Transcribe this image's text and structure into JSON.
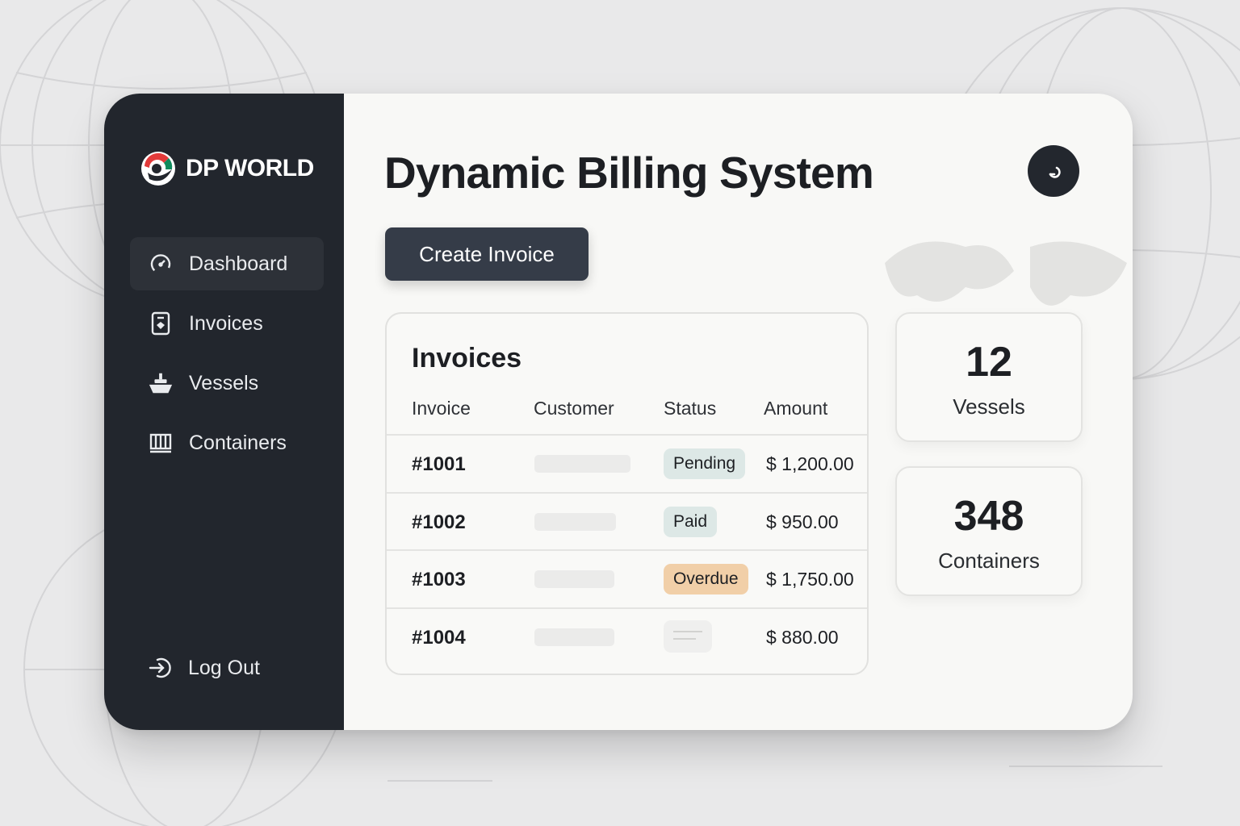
{
  "brand": {
    "name": "DP WORLD"
  },
  "sidebar": {
    "items": [
      {
        "label": "Dashboard",
        "icon": "gauge-icon",
        "active": true
      },
      {
        "label": "Invoices",
        "icon": "invoice-icon",
        "active": false
      },
      {
        "label": "Vessels",
        "icon": "ship-icon",
        "active": false
      },
      {
        "label": "Containers",
        "icon": "container-icon",
        "active": false
      }
    ],
    "logout_label": "Log Out"
  },
  "header": {
    "title": "Dynamic Billing System",
    "action_icon": "refresh-icon"
  },
  "toolbar": {
    "create_label": "Create Invoice"
  },
  "invoices": {
    "title": "Invoices",
    "columns": [
      "Invoice",
      "Customer",
      "Status",
      "Amount"
    ],
    "rows": [
      {
        "id": "#1001",
        "status": "Pending",
        "status_color": "#dde8e6",
        "amount": "$ 1,200.00"
      },
      {
        "id": "#1002",
        "status": "Paid",
        "status_color": "#dde8e6",
        "amount": "$ 950.00"
      },
      {
        "id": "#1003",
        "status": "Overdue",
        "status_color": "#f1cfa8",
        "amount": "$ 1,750.00"
      },
      {
        "id": "#1004",
        "status": "",
        "status_color": "#efefee",
        "amount": "$ 880.00"
      }
    ]
  },
  "stats": [
    {
      "value": "12",
      "label": "Vessels"
    },
    {
      "value": "348",
      "label": "Containers"
    }
  ],
  "colors": {
    "sidebar_bg": "#22262d",
    "primary_button": "#353c48",
    "badge_neutral": "#dde8e6",
    "badge_overdue": "#f1cfa8"
  }
}
